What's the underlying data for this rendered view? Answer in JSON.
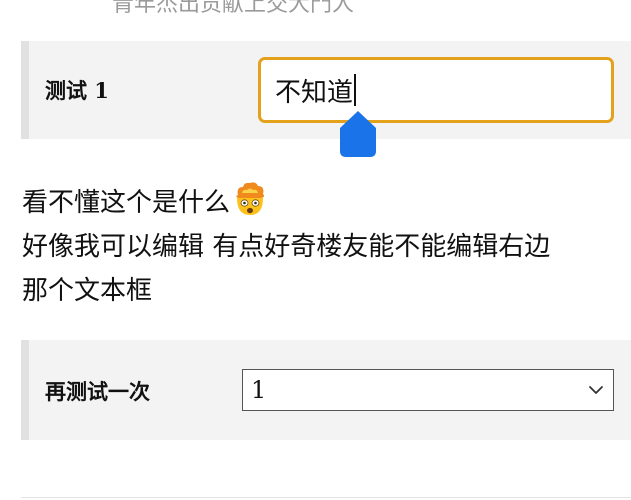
{
  "header": {
    "partial_text": "青年杰出贡献上交大門人"
  },
  "form": {
    "row1": {
      "label": "测试 1",
      "input_value": "不知道"
    },
    "row2": {
      "label": "再测试一次",
      "selected_value": "1"
    }
  },
  "comment": {
    "line1": "看不懂这个是什么",
    "line2": "好像我可以编辑 有点好奇楼友能不能编辑右边",
    "line3": "那个文本框",
    "emoji": "exploding-head-emoji"
  },
  "colors": {
    "focus_border": "#e4a11b",
    "cursor_handle": "#1a73e8",
    "row_background": "#f3f3f3",
    "row_accent": "#e1e1e1"
  },
  "icons": {
    "select_chevron": "chevron-down-icon",
    "text_handle": "text-cursor-handle-icon"
  }
}
